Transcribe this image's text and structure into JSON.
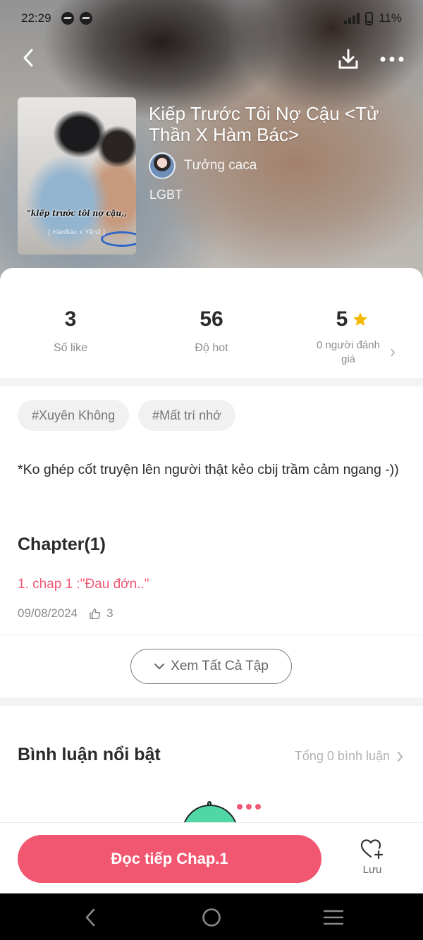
{
  "status_bar": {
    "time": "22:29",
    "battery": "11%"
  },
  "story": {
    "title": "Kiếp Trước Tôi Nợ Cậu <Tử Thần X Hàm Bác>",
    "author": "Tưởng caca",
    "genre": "LGBT",
    "cover_caption": "\"kiếp trước tôi nợ cậu,,",
    "cover_subcaption": "[ HànBác x Yên2 ]"
  },
  "stats": {
    "likes_value": "3",
    "likes_label": "Số like",
    "hot_value": "56",
    "hot_label": "Độ hot",
    "rating_value": "5",
    "rating_label": "0 người đánh giá"
  },
  "tags": [
    "#Xuyên Không",
    "#Mất trí nhớ"
  ],
  "description": "*Ko ghép cốt truyện lên người thật kẻo cbij trầm cảm ngang -))",
  "chapters": {
    "heading": "Chapter(1)",
    "items": [
      {
        "title": "1. chap 1 :\"Đau đớn..\"",
        "date": "09/08/2024",
        "likes": "3"
      }
    ],
    "view_all_label": "Xem Tất Cả Tập"
  },
  "comments": {
    "heading": "Bình luận nổi bật",
    "total_label": "Tổng 0 bình luận"
  },
  "actions": {
    "read_label": "Đọc tiếp Chap.1",
    "save_label": "Lưu"
  },
  "colors": {
    "accent": "#f25771",
    "chapter_link": "#ef5a74",
    "star": "#f5b800"
  }
}
